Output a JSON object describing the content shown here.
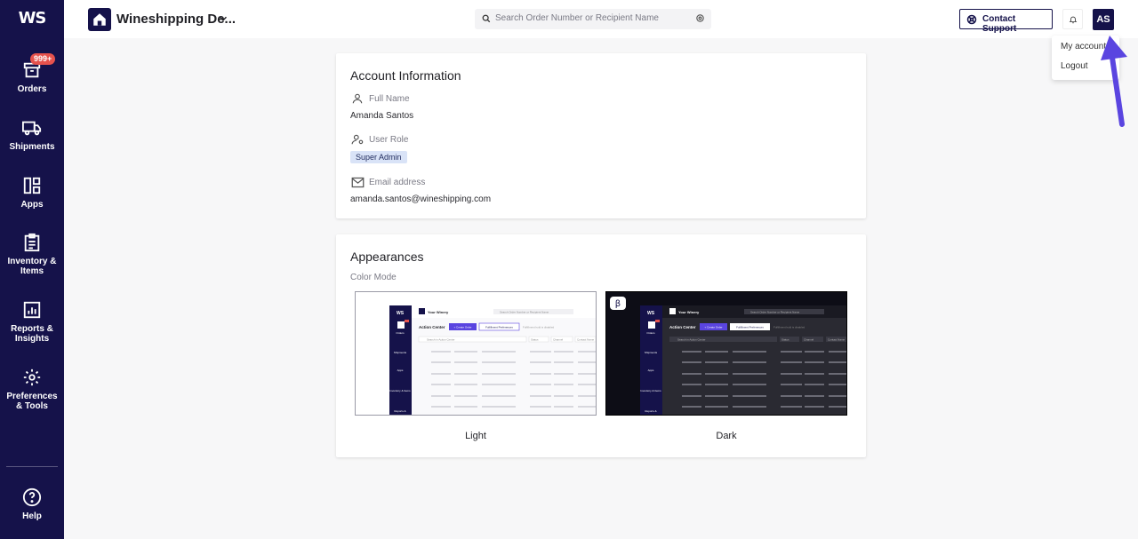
{
  "sidebar": {
    "logo": "WS",
    "items": [
      {
        "label": "Orders",
        "badge": "999+",
        "icon": "orders-box-icon"
      },
      {
        "label": "Shipments",
        "icon": "truck-icon"
      },
      {
        "label": "Apps",
        "icon": "apps-grid-icon"
      },
      {
        "label": "Inventory & Items",
        "icon": "clipboard-icon"
      },
      {
        "label": "Reports & Insights",
        "icon": "bar-chart-icon"
      },
      {
        "label": "Preferences & Tools",
        "icon": "gear-icon"
      },
      {
        "label": "Help",
        "icon": "help-circle-icon"
      }
    ]
  },
  "header": {
    "store_name": "Wineshipping De...",
    "search_placeholder": "Search Order Number or Recipient Name",
    "support_label": "Contact Support",
    "avatar_initials": "AS"
  },
  "dropdown": {
    "items": [
      "My account",
      "Logout"
    ]
  },
  "account": {
    "title": "Account Information",
    "full_name_label": "Full Name",
    "full_name": "Amanda Santos",
    "role_label": "User Role",
    "role": "Super Admin",
    "email_label": "Email address",
    "email": "amanda.santos@wineshipping.com"
  },
  "appearance": {
    "title": "Appearances",
    "subtitle": "Color Mode",
    "light_label": "Light",
    "dark_label": "Dark",
    "beta_glyph": "β",
    "preview": {
      "logo": "WS",
      "winery": "Your Winery",
      "search": "Search Order Number or Recipient Name",
      "heading": "Action Center",
      "create_btn": "+ Create Order",
      "prefs_btn": "Fulfillment Preferences",
      "hint": "Fulfillment hold is disabled",
      "filter_search": "Search in Action Center",
      "filter_status": "Status",
      "filter_channel": "Channel",
      "filter_contact": "Contact Name",
      "nav": [
        "Orders",
        "Shipments",
        "Apps",
        "Inventory & Items",
        "Reports &"
      ]
    }
  },
  "colors": {
    "sidebar_bg": "#15124a",
    "badge": "#e6524d",
    "arrow": "#5a45e0",
    "role_tag_bg": "#d9e3f7"
  }
}
